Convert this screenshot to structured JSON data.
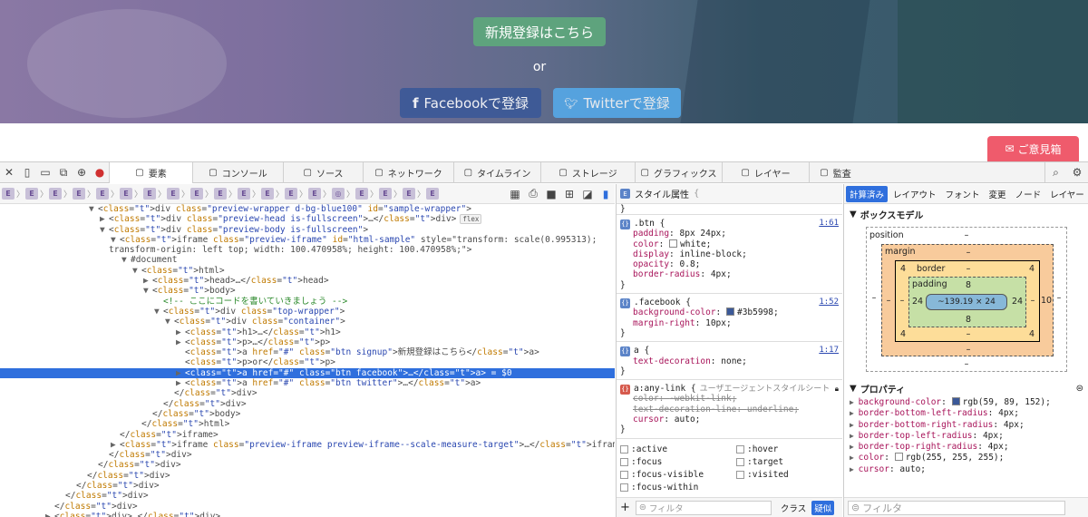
{
  "hero": {
    "signup_label": "新規登録はこちら",
    "or_label": "or",
    "facebook_label": "Facebookで登録",
    "twitter_label": "Twitterで登録",
    "feedback_label": "ご意見箱"
  },
  "devtools": {
    "tabs": [
      {
        "label": "要素",
        "icon": "elements-icon",
        "active": true
      },
      {
        "label": "コンソール",
        "icon": "console-icon"
      },
      {
        "label": "ソース",
        "icon": "sources-icon"
      },
      {
        "label": "ネットワーク",
        "icon": "network-icon"
      },
      {
        "label": "タイムライン",
        "icon": "timeline-icon"
      },
      {
        "label": "ストレージ",
        "icon": "storage-icon"
      },
      {
        "label": "グラフィックス",
        "icon": "graphics-icon"
      },
      {
        "label": "レイヤー",
        "icon": "layers-icon"
      },
      {
        "label": "監査",
        "icon": "audit-icon"
      }
    ],
    "breadcrumb_count": 19,
    "dom_lines": [
      {
        "indent": 9,
        "html": "&lt;div class=\"preview-wrapper d-bg-blue100\" id=\"sample-wrapper\"&gt;",
        "tri": "▼"
      },
      {
        "indent": 10,
        "html": "&lt;div class=\"preview-head is-fullscreen\"&gt;…&lt;/div&gt;",
        "tri": "▶",
        "badge": "flex"
      },
      {
        "indent": 10,
        "html": "&lt;div class=\"preview-body is-fullscreen\"&gt;",
        "tri": "▼"
      },
      {
        "indent": 11,
        "html": "&lt;iframe class=\"preview-iframe\" id=\"html-sample\" style=\"transform: scale(0.995313);",
        "tri": "▼"
      },
      {
        "indent": 10,
        "html": "transform-origin: left top; width: 100.470958%; height: 100.470958%;\"&gt;",
        "tri": ""
      },
      {
        "indent": 12,
        "html": "#document",
        "tri": "▼"
      },
      {
        "indent": 13,
        "html": "&lt;html&gt;",
        "tri": "▼"
      },
      {
        "indent": 14,
        "html": "&lt;head&gt;…&lt;/head&gt;",
        "tri": "▶"
      },
      {
        "indent": 14,
        "html": "&lt;body&gt;",
        "tri": "▼"
      },
      {
        "indent": 15,
        "html": "&lt;!-- ここにコードを書いていきましょう --&gt;",
        "tri": "",
        "comment": true
      },
      {
        "indent": 15,
        "html": "&lt;div class=\"top-wrapper\"&gt;",
        "tri": "▼"
      },
      {
        "indent": 16,
        "html": "&lt;div class=\"container\"&gt;",
        "tri": "▼"
      },
      {
        "indent": 17,
        "html": "&lt;h1&gt;…&lt;/h1&gt;",
        "tri": "▶"
      },
      {
        "indent": 17,
        "html": "&lt;p&gt;…&lt;/p&gt;",
        "tri": "▶"
      },
      {
        "indent": 17,
        "html": "&lt;a href=\"#\" class=\"btn signup\"&gt;新規登録はこちら&lt;/a&gt;",
        "tri": ""
      },
      {
        "indent": 17,
        "html": "&lt;p&gt;or&lt;/p&gt;",
        "tri": ""
      },
      {
        "indent": 17,
        "html": "&lt;a href=\"#\" class=\"btn facebook\"&gt;…&lt;/a&gt; = $0",
        "tri": "▶",
        "selected": true
      },
      {
        "indent": 17,
        "html": "&lt;a href=\"#\" class=\"btn twitter\"&gt;…&lt;/a&gt;",
        "tri": "▶"
      },
      {
        "indent": 16,
        "html": "&lt;/div&gt;",
        "tri": ""
      },
      {
        "indent": 15,
        "html": "&lt;/div&gt;",
        "tri": ""
      },
      {
        "indent": 14,
        "html": "&lt;/body&gt;",
        "tri": ""
      },
      {
        "indent": 13,
        "html": "&lt;/html&gt;",
        "tri": ""
      },
      {
        "indent": 11,
        "html": "&lt;/iframe&gt;",
        "tri": ""
      },
      {
        "indent": 11,
        "html": "&lt;iframe class=\"preview-iframe preview-iframe--scale-measure-target\"&gt;…&lt;/iframe&gt;",
        "tri": "▶"
      },
      {
        "indent": 10,
        "html": "&lt;/div&gt;",
        "tri": ""
      },
      {
        "indent": 9,
        "html": "&lt;/div&gt;",
        "tri": ""
      },
      {
        "indent": 8,
        "html": "&lt;/div&gt;",
        "tri": ""
      },
      {
        "indent": 7,
        "html": "&lt;/div&gt;",
        "tri": ""
      },
      {
        "indent": 6,
        "html": "&lt;/div&gt;",
        "tri": ""
      },
      {
        "indent": 5,
        "html": "&lt;/div&gt;",
        "tri": ""
      },
      {
        "indent": 5,
        "html": "&lt;div&gt;…&lt;/div&gt;",
        "tri": "▶"
      }
    ]
  },
  "rules": {
    "style_attr_header": "スタイル属性",
    "btn": {
      "selector": ".btn",
      "line": "1:61",
      "props": [
        [
          "padding",
          "8px 24px;"
        ],
        [
          "color",
          "white;"
        ],
        [
          "display",
          "inline-block;"
        ],
        [
          "opacity",
          "0.8;"
        ],
        [
          "border-radius",
          "4px;"
        ]
      ]
    },
    "facebook": {
      "selector": ".facebook",
      "line": "1:52",
      "props": [
        [
          "background-color",
          "#3b5998;"
        ],
        [
          "margin-right",
          "10px;"
        ]
      ]
    },
    "a": {
      "selector": "a",
      "line": "1:17",
      "props": [
        [
          "text-decoration",
          "none;"
        ]
      ]
    },
    "anylink": {
      "selector": "a:any-link",
      "origin": "ユーザエージェントスタイルシート",
      "props": [
        [
          "color",
          "-webkit-link;"
        ],
        [
          "text-decoration-line",
          "underline;"
        ],
        [
          "cursor",
          "auto;"
        ]
      ]
    },
    "pseudo": [
      ":active",
      ":hover",
      ":focus",
      ":target",
      ":focus-visible",
      ":visited",
      ":focus-within"
    ],
    "filter_placeholder": "フィルタ",
    "class_label": "クラス",
    "pseudo_label": "疑似",
    "colors": {
      "facebook": "#3b5998",
      "white": "#ffffff"
    }
  },
  "side": {
    "tabs": [
      "計算済み",
      "レイアウト",
      "フォント",
      "変更",
      "ノード",
      "レイヤー"
    ],
    "boxmodel_title": "ボックスモデル",
    "position_label": "position",
    "margin_label": "margin",
    "border_label": "border",
    "padding_label": "padding",
    "content_size": "~139.19 × 24",
    "dash": "–",
    "border_top": "4",
    "border_right": "4",
    "border_left": "4",
    "border_bottom_l": "4",
    "border_bottom_r": "4",
    "padding_top": "8",
    "padding_bottom": "8",
    "padding_left": "24",
    "padding_right": "24",
    "margin_right": "10",
    "props_title": "プロパティ",
    "props": [
      [
        "background-color",
        "rgb(59, 89, 152);",
        "#3b5998"
      ],
      [
        "border-bottom-left-radius",
        "4px;",
        ""
      ],
      [
        "border-bottom-right-radius",
        "4px;",
        ""
      ],
      [
        "border-top-left-radius",
        "4px;",
        ""
      ],
      [
        "border-top-right-radius",
        "4px;",
        ""
      ],
      [
        "color",
        "rgb(255, 255, 255);",
        "#ffffff"
      ],
      [
        "cursor",
        "auto;",
        ""
      ]
    ],
    "filter_placeholder": "フィルタ"
  }
}
